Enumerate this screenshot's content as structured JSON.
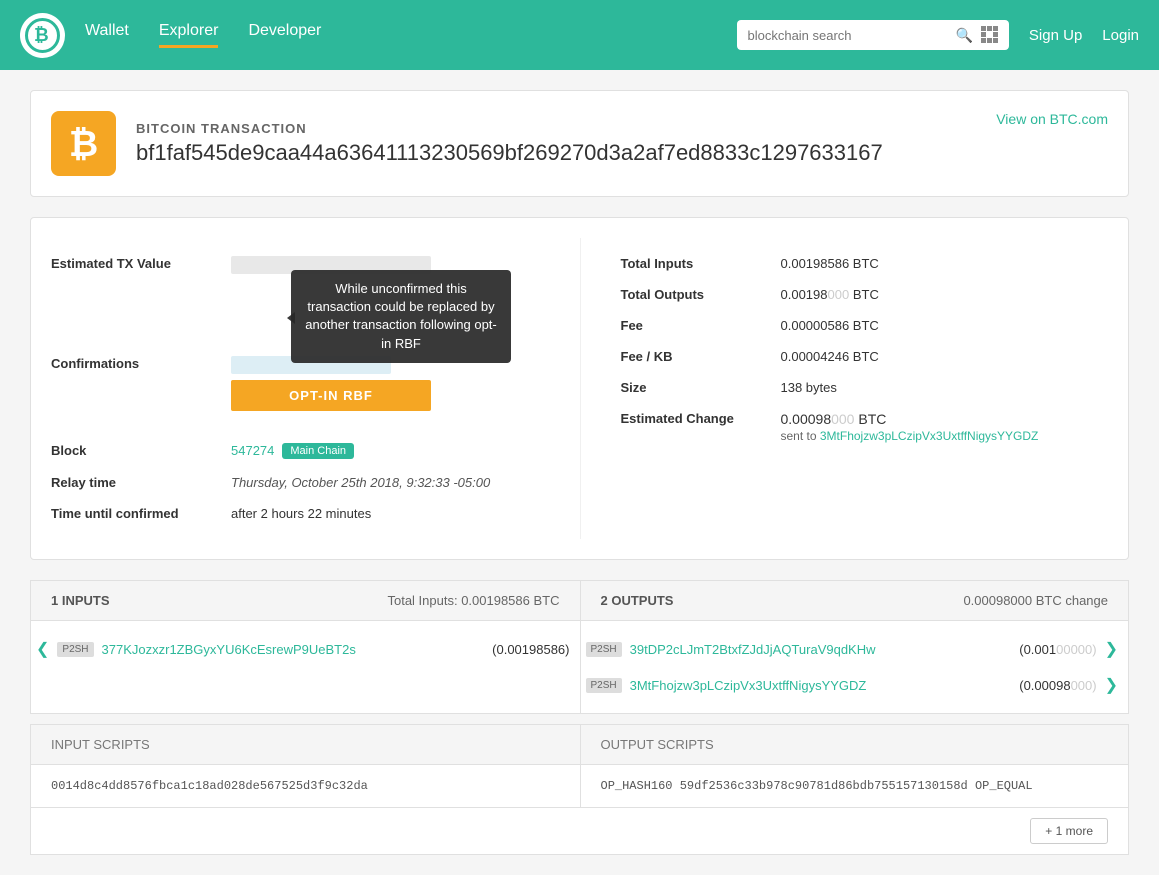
{
  "header": {
    "logo_text": "B",
    "nav": [
      {
        "label": "Wallet",
        "active": false
      },
      {
        "label": "Explorer",
        "active": true
      },
      {
        "label": "Developer",
        "active": false
      }
    ],
    "search_placeholder": "blockchain search",
    "signup_label": "Sign Up",
    "login_label": "Login"
  },
  "transaction": {
    "label": "BITCOIN TRANSACTION",
    "hash": "bf1faf545de9caa44a63641113230569bf269270d3a2af7ed8833c1297633167",
    "view_link": "View on BTC.com"
  },
  "details": {
    "estimated_tx_label": "Estimated TX Value",
    "confirmations_label": "Confirmations",
    "block_label": "Block",
    "block_value": "547274",
    "block_badge": "Main Chain",
    "relay_time_label": "Relay time",
    "relay_time_value": "Thursday, October 25th 2018, 9:32:33 -05:00",
    "time_until_label": "Time until confirmed",
    "time_until_value": "after 2 hours 22 minutes",
    "optin_rbf_label": "OPT-IN RBF",
    "tooltip_text": "While unconfirmed this transaction could be replaced by another transaction following opt-in RBF"
  },
  "stats": {
    "total_inputs_label": "Total Inputs",
    "total_inputs_value": "0.00198586 BTC",
    "total_outputs_label": "Total Outputs",
    "total_outputs_value_prefix": "0.00198",
    "total_outputs_value_suffix": "000",
    "total_outputs_unit": "BTC",
    "fee_label": "Fee",
    "fee_value": "0.00000586 BTC",
    "fee_kb_label": "Fee / KB",
    "fee_kb_value": "0.00004246 BTC",
    "size_label": "Size",
    "size_value": "138 bytes",
    "est_change_label": "Estimated Change",
    "est_change_prefix": "0.00098",
    "est_change_suffix": "000",
    "est_change_unit": "BTC",
    "est_change_sent": "sent to",
    "est_change_address": "3MtFhojzw3pLCzipVx3UxtffNigysYYGDZ"
  },
  "inputs": {
    "header": "1 INPUTS",
    "total_label": "Total Inputs: 0.00198586 BTC",
    "rows": [
      {
        "badge": "P2SH",
        "address": "377KJozxzr1ZBGyxYU6KcEsrewP9UeBT2s",
        "amount": "(0.00198586)"
      }
    ]
  },
  "outputs": {
    "header": "2 OUTPUTS",
    "total_label": "0.00098000 BTC change",
    "rows": [
      {
        "badge": "P2SH",
        "address": "39tDP2cLJmT2BtxfZJdJjAQTuraV9qdKHw",
        "amount_prefix": "(0.001",
        "amount_suffix": "00000)"
      },
      {
        "badge": "P2SH",
        "address": "3MtFhojzw3pLCzipVx3UxtffNigysYYGDZ",
        "amount_prefix": "(0.00098",
        "amount_suffix": "000)"
      }
    ]
  },
  "scripts": {
    "input_label": "INPUT SCRIPTS",
    "output_label": "OUTPUT SCRIPTS",
    "input_value": "0014d8c4dd8576fbca1c18ad028de567525d3f9c32da",
    "output_value": "OP_HASH160 59df2536c33b978c90781d86bdb755157130158d OP_EQUAL",
    "more_btn": "+ 1 more"
  }
}
